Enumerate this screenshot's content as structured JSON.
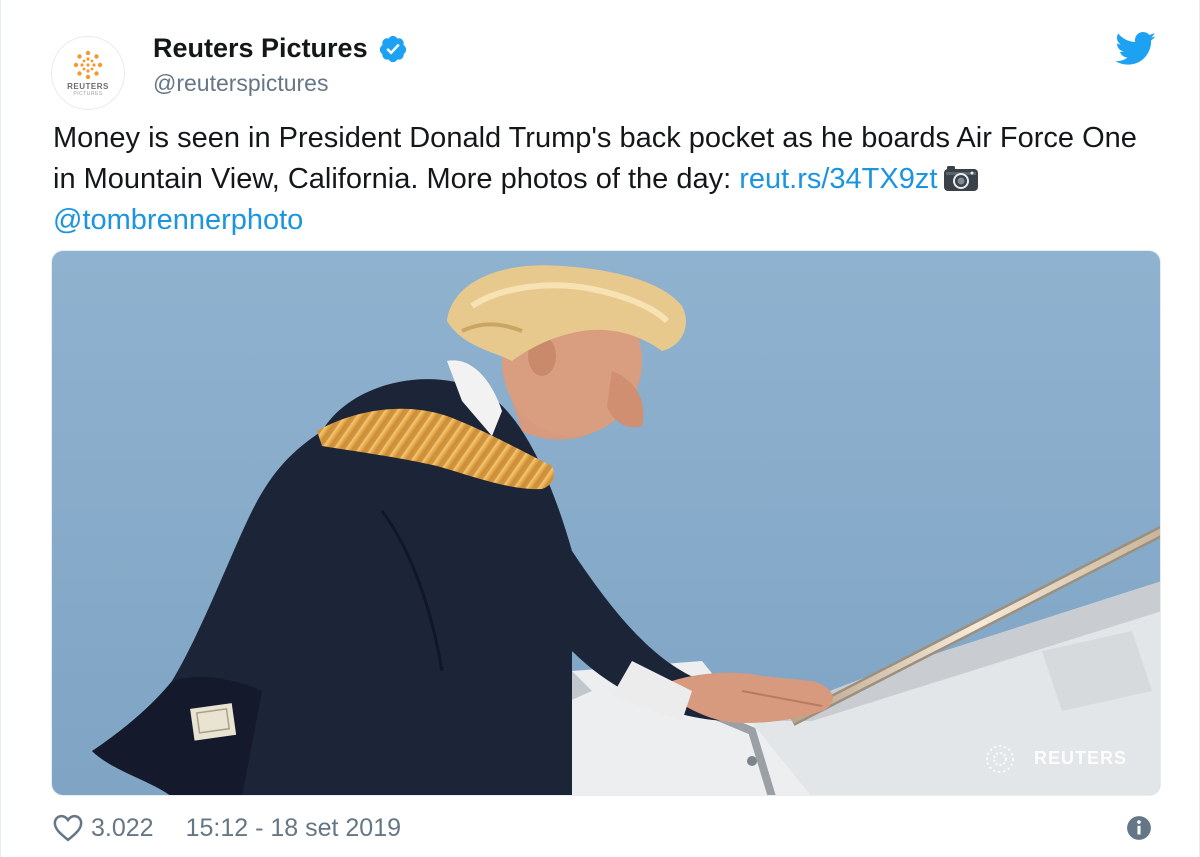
{
  "account": {
    "display_name": "Reuters Pictures",
    "handle": "@reuterspictures",
    "avatar_text": "REUTERS",
    "avatar_subtext": "PICTURES",
    "verified": true
  },
  "tweet": {
    "text_part1": "Money is seen in President Donald Trump's back pocket as he boards Air Force One in Mountain View, California. More photos of the day: ",
    "link": "reut.rs/34TX9zt",
    "mention": "@tombrennerphoto"
  },
  "photo": {
    "watermark": "REUTERS"
  },
  "footer": {
    "likes": "3.022",
    "timestamp": "15:12 - 18 set 2019"
  },
  "icons": {
    "verified": "verified-badge-icon",
    "bird": "twitter-bird-icon",
    "camera": "camera-icon",
    "heart": "heart-icon",
    "info": "info-icon"
  },
  "colors": {
    "brand_blue": "#1da1f2",
    "link_blue": "#1b95e0",
    "text": "#14171a",
    "secondary": "#657786",
    "reuters_orange": "#f29a2e"
  }
}
